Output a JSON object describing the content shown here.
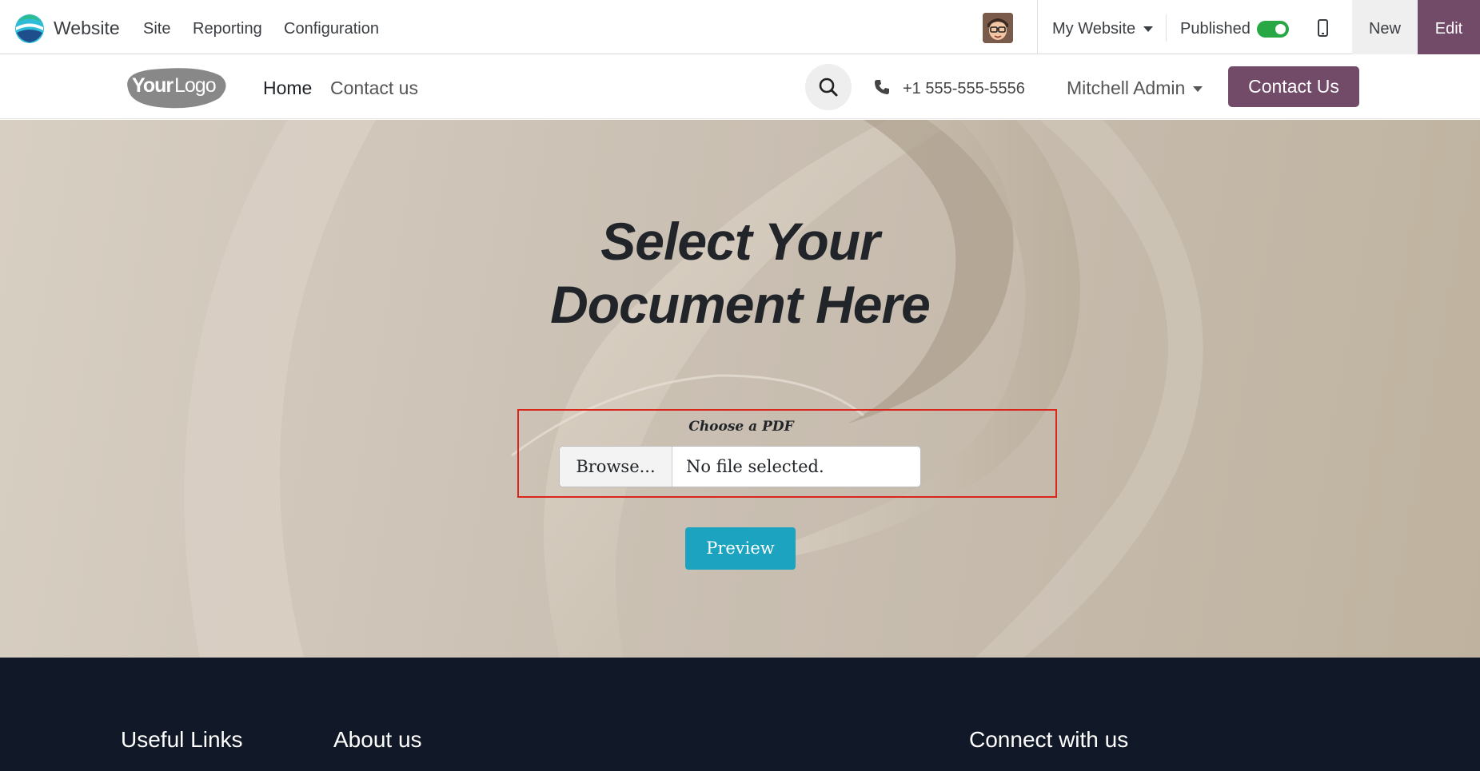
{
  "topbar": {
    "app_name": "Website",
    "menus": [
      "Site",
      "Reporting",
      "Configuration"
    ],
    "website_selector": "My Website",
    "published_label": "Published",
    "published": true,
    "new_label": "New",
    "edit_label": "Edit",
    "accent_color": "#714b67"
  },
  "header": {
    "logo_text": "YourLogo",
    "nav": [
      "Home",
      "Contact us"
    ],
    "phone": "+1 555-555-5556",
    "user_name": "Mitchell Admin",
    "cta_label": "Contact Us"
  },
  "hero": {
    "title": "Select Your Document Here",
    "upload_label": "Choose a PDF",
    "browse_label": "Browse...",
    "file_status": "No file selected.",
    "preview_label": "Preview",
    "preview_color": "#1ca3c0"
  },
  "footer": {
    "headings": [
      "Useful Links",
      "About us",
      "Connect with us"
    ]
  }
}
